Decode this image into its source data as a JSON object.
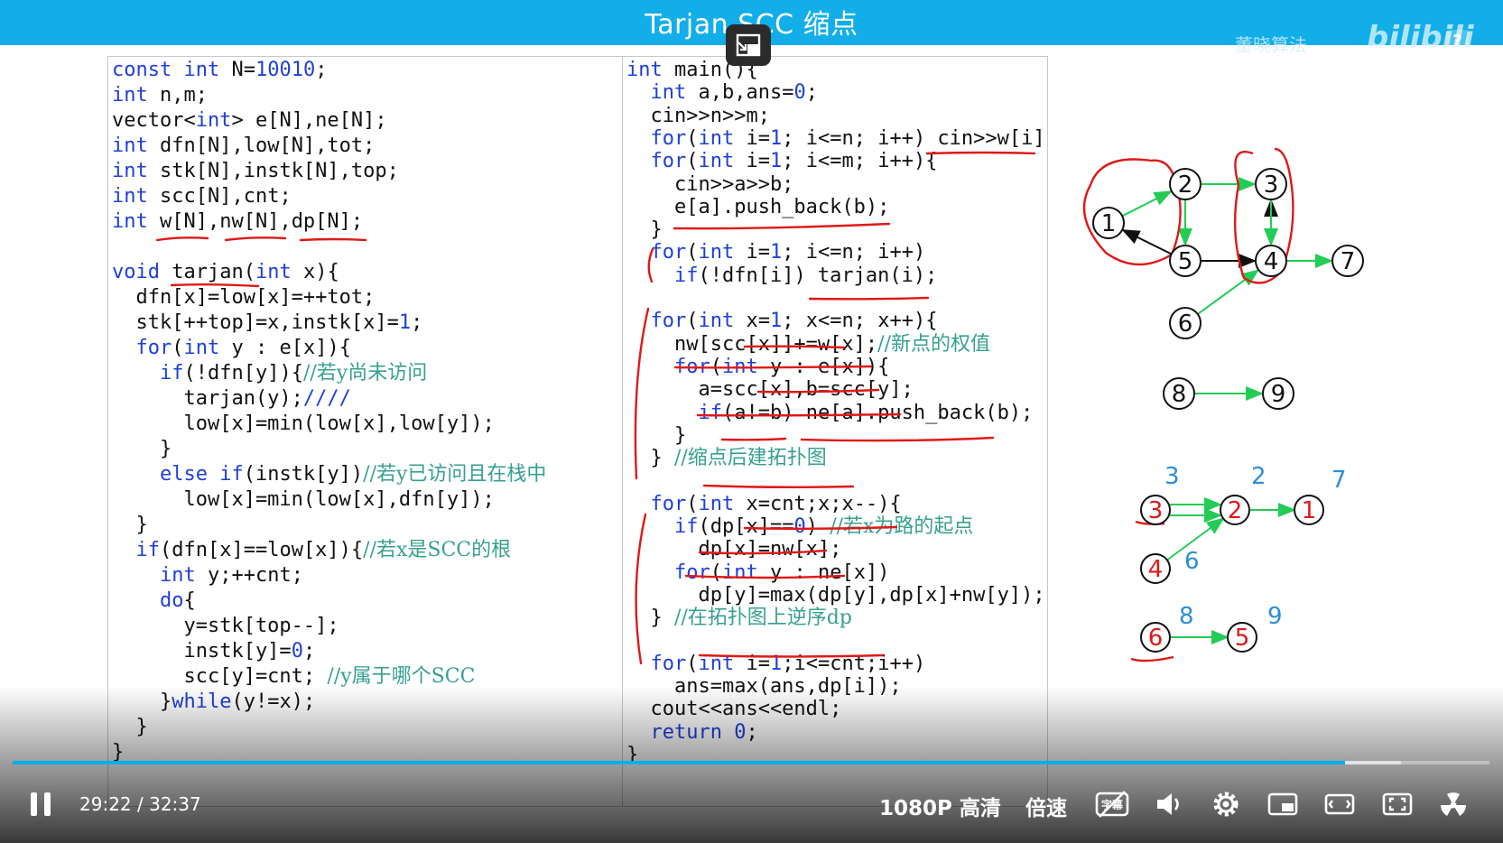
{
  "title": "Tarjan SCC 缩点",
  "watermark": "董晓算法",
  "logo": "bilibili",
  "help_icon": "?",
  "code_left": [
    [
      {
        "t": "const int",
        "c": "kw"
      },
      {
        "t": " N="
      },
      {
        "t": "10010",
        "c": "num"
      },
      {
        "t": ";"
      }
    ],
    [
      {
        "t": "int",
        "c": "kw"
      },
      {
        "t": " n,m;"
      }
    ],
    [
      {
        "t": "vector<"
      },
      {
        "t": "int",
        "c": "kw"
      },
      {
        "t": "> e[N],ne[N];"
      }
    ],
    [
      {
        "t": "int",
        "c": "kw"
      },
      {
        "t": " dfn[N],low[N],tot;"
      }
    ],
    [
      {
        "t": "int",
        "c": "kw"
      },
      {
        "t": " stk[N],instk[N],top;"
      }
    ],
    [
      {
        "t": "int",
        "c": "kw"
      },
      {
        "t": " scc[N],cnt;"
      }
    ],
    [
      {
        "t": "int",
        "c": "kw"
      },
      {
        "t": " w[N],nw[N],dp[N];"
      }
    ],
    [],
    [
      {
        "t": "void",
        "c": "kw"
      },
      {
        "t": " tarjan("
      },
      {
        "t": "int",
        "c": "kw"
      },
      {
        "t": " x){"
      }
    ],
    [
      {
        "t": "  dfn[x]=low[x]=++tot;"
      }
    ],
    [
      {
        "t": "  stk[++top]=x,instk[x]="
      },
      {
        "t": "1",
        "c": "num"
      },
      {
        "t": ";"
      }
    ],
    [
      {
        "t": "  "
      },
      {
        "t": "for",
        "c": "kw"
      },
      {
        "t": "("
      },
      {
        "t": "int",
        "c": "kw"
      },
      {
        "t": " y : e[x]){"
      }
    ],
    [
      {
        "t": "    "
      },
      {
        "t": "if",
        "c": "kw"
      },
      {
        "t": "(!dfn[y]){"
      },
      {
        "t": "//若y尚未访问",
        "c": "cm"
      }
    ],
    [
      {
        "t": "      tarjan(y);"
      },
      {
        "t": "////",
        "c": "kw"
      }
    ],
    [
      {
        "t": "      low[x]=min(low[x],low[y]);"
      }
    ],
    [
      {
        "t": "    }"
      }
    ],
    [
      {
        "t": "    "
      },
      {
        "t": "else if",
        "c": "kw"
      },
      {
        "t": "(instk[y])"
      },
      {
        "t": "//若y已访问且在栈中",
        "c": "cm"
      }
    ],
    [
      {
        "t": "      low[x]=min(low[x],dfn[y]);"
      }
    ],
    [
      {
        "t": "  }"
      }
    ],
    [
      {
        "t": "  "
      },
      {
        "t": "if",
        "c": "kw"
      },
      {
        "t": "(dfn[x]==low[x]){"
      },
      {
        "t": "//若x是SCC的根",
        "c": "cm"
      }
    ],
    [
      {
        "t": "    "
      },
      {
        "t": "int",
        "c": "kw"
      },
      {
        "t": " y;++cnt;"
      }
    ],
    [
      {
        "t": "    "
      },
      {
        "t": "do",
        "c": "kw"
      },
      {
        "t": "{"
      }
    ],
    [
      {
        "t": "      y=stk[top--];"
      }
    ],
    [
      {
        "t": "      instk[y]="
      },
      {
        "t": "0",
        "c": "num"
      },
      {
        "t": ";"
      }
    ],
    [
      {
        "t": "      scc[y]=cnt; "
      },
      {
        "t": "//y属于哪个SCC",
        "c": "cm"
      }
    ],
    [
      {
        "t": "    }"
      },
      {
        "t": "while",
        "c": "kw"
      },
      {
        "t": "(y!=x);"
      }
    ],
    [
      {
        "t": "  }"
      }
    ],
    [
      {
        "t": "}"
      }
    ]
  ],
  "code_right": [
    [
      {
        "t": "int",
        "c": "kw"
      },
      {
        "t": " main(){"
      }
    ],
    [
      {
        "t": "  "
      },
      {
        "t": "int",
        "c": "kw"
      },
      {
        "t": " a,b,ans="
      },
      {
        "t": "0",
        "c": "num"
      },
      {
        "t": ";"
      }
    ],
    [
      {
        "t": "  cin>>n>>m;"
      }
    ],
    [
      {
        "t": "  "
      },
      {
        "t": "for",
        "c": "kw"
      },
      {
        "t": "("
      },
      {
        "t": "int",
        "c": "kw"
      },
      {
        "t": " i="
      },
      {
        "t": "1",
        "c": "num"
      },
      {
        "t": "; i<=n; i++) cin>>w[i];"
      }
    ],
    [
      {
        "t": "  "
      },
      {
        "t": "for",
        "c": "kw"
      },
      {
        "t": "("
      },
      {
        "t": "int",
        "c": "kw"
      },
      {
        "t": " i="
      },
      {
        "t": "1",
        "c": "num"
      },
      {
        "t": "; i<=m; i++){"
      }
    ],
    [
      {
        "t": "    cin>>a>>b;"
      }
    ],
    [
      {
        "t": "    e[a].push_back(b);"
      }
    ],
    [
      {
        "t": "  }"
      }
    ],
    [
      {
        "t": "  "
      },
      {
        "t": "for",
        "c": "kw"
      },
      {
        "t": "("
      },
      {
        "t": "int",
        "c": "kw"
      },
      {
        "t": " i="
      },
      {
        "t": "1",
        "c": "num"
      },
      {
        "t": "; i<=n; i++)"
      }
    ],
    [
      {
        "t": "    "
      },
      {
        "t": "if",
        "c": "kw"
      },
      {
        "t": "(!dfn[i]) tarjan(i);"
      }
    ],
    [],
    [
      {
        "t": "  "
      },
      {
        "t": "for",
        "c": "kw"
      },
      {
        "t": "("
      },
      {
        "t": "int",
        "c": "kw"
      },
      {
        "t": " x="
      },
      {
        "t": "1",
        "c": "num"
      },
      {
        "t": "; x<=n; x++){"
      }
    ],
    [
      {
        "t": "    nw[scc[x]]+=w[x];"
      },
      {
        "t": "//新点的权值",
        "c": "cm"
      }
    ],
    [
      {
        "t": "    "
      },
      {
        "t": "for",
        "c": "kw"
      },
      {
        "t": "("
      },
      {
        "t": "int",
        "c": "kw"
      },
      {
        "t": " y : e[x]){"
      }
    ],
    [
      {
        "t": "      a=scc[x],b=scc[y];"
      }
    ],
    [
      {
        "t": "      "
      },
      {
        "t": "if",
        "c": "kw"
      },
      {
        "t": "(a!=b) ne[a].push_back(b);"
      }
    ],
    [
      {
        "t": "    }"
      }
    ],
    [
      {
        "t": "  } "
      },
      {
        "t": "//缩点后建拓扑图",
        "c": "cm"
      }
    ],
    [],
    [
      {
        "t": "  "
      },
      {
        "t": "for",
        "c": "kw"
      },
      {
        "t": "("
      },
      {
        "t": "int",
        "c": "kw"
      },
      {
        "t": " x=cnt;x;x--){"
      }
    ],
    [
      {
        "t": "    "
      },
      {
        "t": "if",
        "c": "kw"
      },
      {
        "t": "(dp[x]=="
      },
      {
        "t": "0",
        "c": "num"
      },
      {
        "t": ") "
      },
      {
        "t": "//若x为路的起点",
        "c": "cm"
      }
    ],
    [
      {
        "t": "      dp[x]=nw[x];"
      }
    ],
    [
      {
        "t": "    "
      },
      {
        "t": "for",
        "c": "kw"
      },
      {
        "t": "("
      },
      {
        "t": "int",
        "c": "kw"
      },
      {
        "t": " y : ne[x])"
      }
    ],
    [
      {
        "t": "      dp[y]=max(dp[y],dp[x]+nw[y]);"
      }
    ],
    [
      {
        "t": "  } "
      },
      {
        "t": "//在拓扑图上逆序dp",
        "c": "cm"
      }
    ],
    [],
    [
      {
        "t": "  "
      },
      {
        "t": "for",
        "c": "kw"
      },
      {
        "t": "("
      },
      {
        "t": "int",
        "c": "kw"
      },
      {
        "t": " i="
      },
      {
        "t": "1",
        "c": "num"
      },
      {
        "t": ";i<=cnt;i++)"
      }
    ],
    [
      {
        "t": "    ans=max(ans,dp[i]);"
      }
    ],
    [
      {
        "t": "  cout<<ans<<endl;"
      }
    ],
    [
      {
        "t": "  "
      },
      {
        "t": "return",
        "c": "kw"
      },
      {
        "t": " "
      },
      {
        "t": "0",
        "c": "num"
      },
      {
        "t": ";"
      }
    ],
    [
      {
        "t": "}"
      }
    ]
  ],
  "graph": {
    "node_labels": [
      "1",
      "2",
      "3",
      "4",
      "5",
      "6",
      "7",
      "8",
      "9"
    ],
    "dag_nodes": [
      "3",
      "2",
      "1",
      "4",
      "6",
      "5"
    ],
    "dag_weights": [
      "3",
      "2",
      "7",
      "6",
      "8",
      "9"
    ]
  },
  "player": {
    "current_time": "29:22",
    "separator": "/",
    "duration": "32:37",
    "progress_fraction": 0.902,
    "buffered_fraction": 0.94,
    "quality": "1080P 高清",
    "speed": "倍速",
    "subtitle_icon": "字幕",
    "icons": [
      "pause-icon",
      "subtitle-icon",
      "volume-icon",
      "settings-icon",
      "pip-icon",
      "widescreen-icon",
      "fullscreen-icon",
      "danmaku-icon"
    ]
  },
  "colors": {
    "accent": "#11aee9",
    "keyword": "#1f3fd8",
    "comment": "#36a090",
    "ink_red": "#e01818",
    "edge_green": "#22cc55",
    "progress": "#00aeec"
  }
}
